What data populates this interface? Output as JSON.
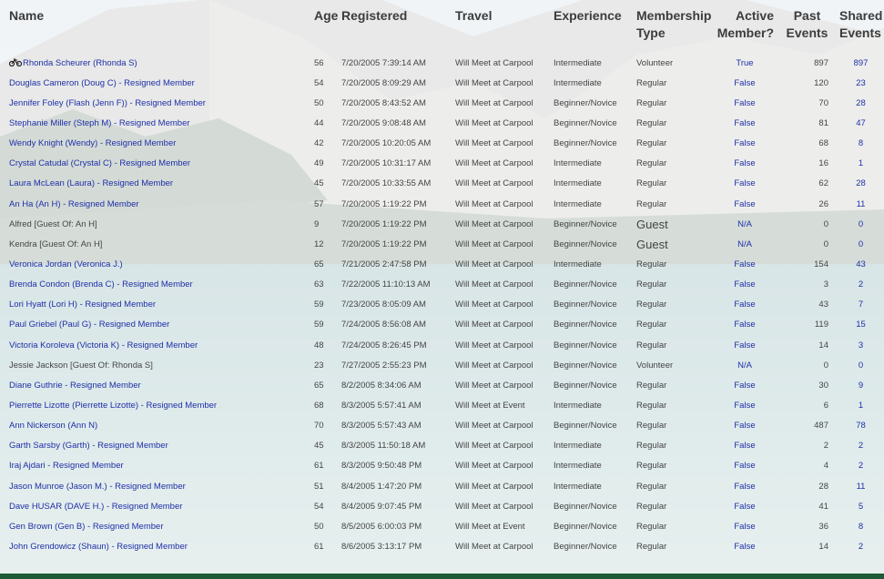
{
  "headers": {
    "name": "Name",
    "age": "Age",
    "registered": "Registered",
    "travel": "Travel",
    "experience": "Experience",
    "membership_type": "Membership Type",
    "active_member": "Active Member?",
    "past_events": "Past Events",
    "shared_events": "Shared Events"
  },
  "rows": [
    {
      "name": "Rhonda Scheurer (Rhonda S)",
      "age": "56",
      "registered": "7/20/2005 7:39:14 AM",
      "travel": "Will Meet at Carpool",
      "experience": "Intermediate",
      "membership": "Volunteer",
      "active": "True",
      "past": "897",
      "shared": "897"
    },
    {
      "name": "Douglas Cameron (Doug C) - Resigned Member",
      "age": "54",
      "registered": "7/20/2005 8:09:29 AM",
      "travel": "Will Meet at Carpool",
      "experience": "Intermediate",
      "membership": "Regular",
      "active": "False",
      "past": "120",
      "shared": "23"
    },
    {
      "name": "Jennifer Foley (Flash (Jenn F)) - Resigned Member",
      "age": "50",
      "registered": "7/20/2005 8:43:52 AM",
      "travel": "Will Meet at Carpool",
      "experience": "Beginner/Novice",
      "membership": "Regular",
      "active": "False",
      "past": "70",
      "shared": "28"
    },
    {
      "name": "Stephanie Miller (Steph M) - Resigned Member",
      "age": "44",
      "registered": "7/20/2005 9:08:48 AM",
      "travel": "Will Meet at Carpool",
      "experience": "Beginner/Novice",
      "membership": "Regular",
      "active": "False",
      "past": "81",
      "shared": "47"
    },
    {
      "name": "Wendy Knight (Wendy) - Resigned Member",
      "age": "42",
      "registered": "7/20/2005 10:20:05 AM",
      "travel": "Will Meet at Carpool",
      "experience": "Beginner/Novice",
      "membership": "Regular",
      "active": "False",
      "past": "68",
      "shared": "8"
    },
    {
      "name": "Crystal Catudal (Crystal C) - Resigned Member",
      "age": "49",
      "registered": "7/20/2005 10:31:17 AM",
      "travel": "Will Meet at Carpool",
      "experience": "Intermediate",
      "membership": "Regular",
      "active": "False",
      "past": "16",
      "shared": "1"
    },
    {
      "name": "Laura McLean (Laura) - Resigned Member",
      "age": "45",
      "registered": "7/20/2005 10:33:55 AM",
      "travel": "Will Meet at Carpool",
      "experience": "Intermediate",
      "membership": "Regular",
      "active": "False",
      "past": "62",
      "shared": "28"
    },
    {
      "name": "An Ha (An H) - Resigned Member",
      "age": "57",
      "registered": "7/20/2005 1:19:22 PM",
      "travel": "Will Meet at Carpool",
      "experience": "Intermediate",
      "membership": "Regular",
      "active": "False",
      "past": "26",
      "shared": "11"
    },
    {
      "name": "Alfred [Guest Of: An H]",
      "age": "9",
      "registered": "7/20/2005 1:19:22 PM",
      "travel": "Will Meet at Carpool",
      "experience": "Beginner/Novice",
      "membership": "Guest",
      "active": "N/A",
      "past": "0",
      "shared": "0"
    },
    {
      "name": "Kendra [Guest Of: An H]",
      "age": "12",
      "registered": "7/20/2005 1:19:22 PM",
      "travel": "Will Meet at Carpool",
      "experience": "Beginner/Novice",
      "membership": "Guest",
      "active": "N/A",
      "past": "0",
      "shared": "0"
    },
    {
      "name": "Veronica Jordan (Veronica J.)",
      "age": "65",
      "registered": "7/21/2005 2:47:58 PM",
      "travel": "Will Meet at Carpool",
      "experience": "Intermediate",
      "membership": "Regular",
      "active": "False",
      "past": "154",
      "shared": "43"
    },
    {
      "name": "Brenda Condon (Brenda C) - Resigned Member",
      "age": "63",
      "registered": "7/22/2005 11:10:13 AM",
      "travel": "Will Meet at Carpool",
      "experience": "Beginner/Novice",
      "membership": "Regular",
      "active": "False",
      "past": "3",
      "shared": "2"
    },
    {
      "name": "Lori Hyatt (Lori H) - Resigned Member",
      "age": "59",
      "registered": "7/23/2005 8:05:09 AM",
      "travel": "Will Meet at Carpool",
      "experience": "Beginner/Novice",
      "membership": "Regular",
      "active": "False",
      "past": "43",
      "shared": "7"
    },
    {
      "name": "Paul Griebel (Paul G) - Resigned Member",
      "age": "59",
      "registered": "7/24/2005 8:56:08 AM",
      "travel": "Will Meet at Carpool",
      "experience": "Beginner/Novice",
      "membership": "Regular",
      "active": "False",
      "past": "119",
      "shared": "15"
    },
    {
      "name": "Victoria Koroleva (Victoria K) - Resigned Member",
      "age": "48",
      "registered": "7/24/2005 8:26:45 PM",
      "travel": "Will Meet at Carpool",
      "experience": "Beginner/Novice",
      "membership": "Regular",
      "active": "False",
      "past": "14",
      "shared": "3"
    },
    {
      "name": "Jessie Jackson [Guest Of: Rhonda S]",
      "age": "23",
      "registered": "7/27/2005 2:55:23 PM",
      "travel": "Will Meet at Carpool",
      "experience": "Beginner/Novice",
      "membership": "Volunteer",
      "active": "N/A",
      "past": "0",
      "shared": "0"
    },
    {
      "name": "Diane Guthrie - Resigned Member",
      "age": "65",
      "registered": "8/2/2005 8:34:06 AM",
      "travel": "Will Meet at Carpool",
      "experience": "Beginner/Novice",
      "membership": "Regular",
      "active": "False",
      "past": "30",
      "shared": "9"
    },
    {
      "name": "Pierrette Lizotte (Pierrette Lizotte) - Resigned Member",
      "age": "68",
      "registered": "8/3/2005 5:57:41 AM",
      "travel": "Will Meet at Event",
      "experience": "Intermediate",
      "membership": "Regular",
      "active": "False",
      "past": "6",
      "shared": "1"
    },
    {
      "name": "Ann Nickerson (Ann N)",
      "age": "70",
      "registered": "8/3/2005 5:57:43 AM",
      "travel": "Will Meet at Carpool",
      "experience": "Beginner/Novice",
      "membership": "Regular",
      "active": "False",
      "past": "487",
      "shared": "78"
    },
    {
      "name": "Garth Sarsby (Garth) - Resigned Member",
      "age": "45",
      "registered": "8/3/2005 11:50:18 AM",
      "travel": "Will Meet at Carpool",
      "experience": "Intermediate",
      "membership": "Regular",
      "active": "False",
      "past": "2",
      "shared": "2"
    },
    {
      "name": "Iraj Ajdari - Resigned Member",
      "age": "61",
      "registered": "8/3/2005 9:50:48 PM",
      "travel": "Will Meet at Carpool",
      "experience": "Intermediate",
      "membership": "Regular",
      "active": "False",
      "past": "4",
      "shared": "2"
    },
    {
      "name": "Jason Munroe (Jason M.) - Resigned Member",
      "age": "51",
      "registered": "8/4/2005 1:47:20 PM",
      "travel": "Will Meet at Carpool",
      "experience": "Intermediate",
      "membership": "Regular",
      "active": "False",
      "past": "28",
      "shared": "11"
    },
    {
      "name": "Dave HUSAR (DAVE H.) - Resigned Member",
      "age": "54",
      "registered": "8/4/2005 9:07:45 PM",
      "travel": "Will Meet at Carpool",
      "experience": "Beginner/Novice",
      "membership": "Regular",
      "active": "False",
      "past": "41",
      "shared": "5"
    },
    {
      "name": "Gen Brown (Gen B) - Resigned Member",
      "age": "50",
      "registered": "8/5/2005 6:00:03 PM",
      "travel": "Will Meet at Event",
      "experience": "Beginner/Novice",
      "membership": "Regular",
      "active": "False",
      "past": "36",
      "shared": "8"
    },
    {
      "name": "John Grendowicz (Shaun) - Resigned Member",
      "age": "61",
      "registered": "8/6/2005 3:13:17 PM",
      "travel": "Will Meet at Carpool",
      "experience": "Beginner/Novice",
      "membership": "Regular",
      "active": "False",
      "past": "14",
      "shared": "2"
    }
  ]
}
